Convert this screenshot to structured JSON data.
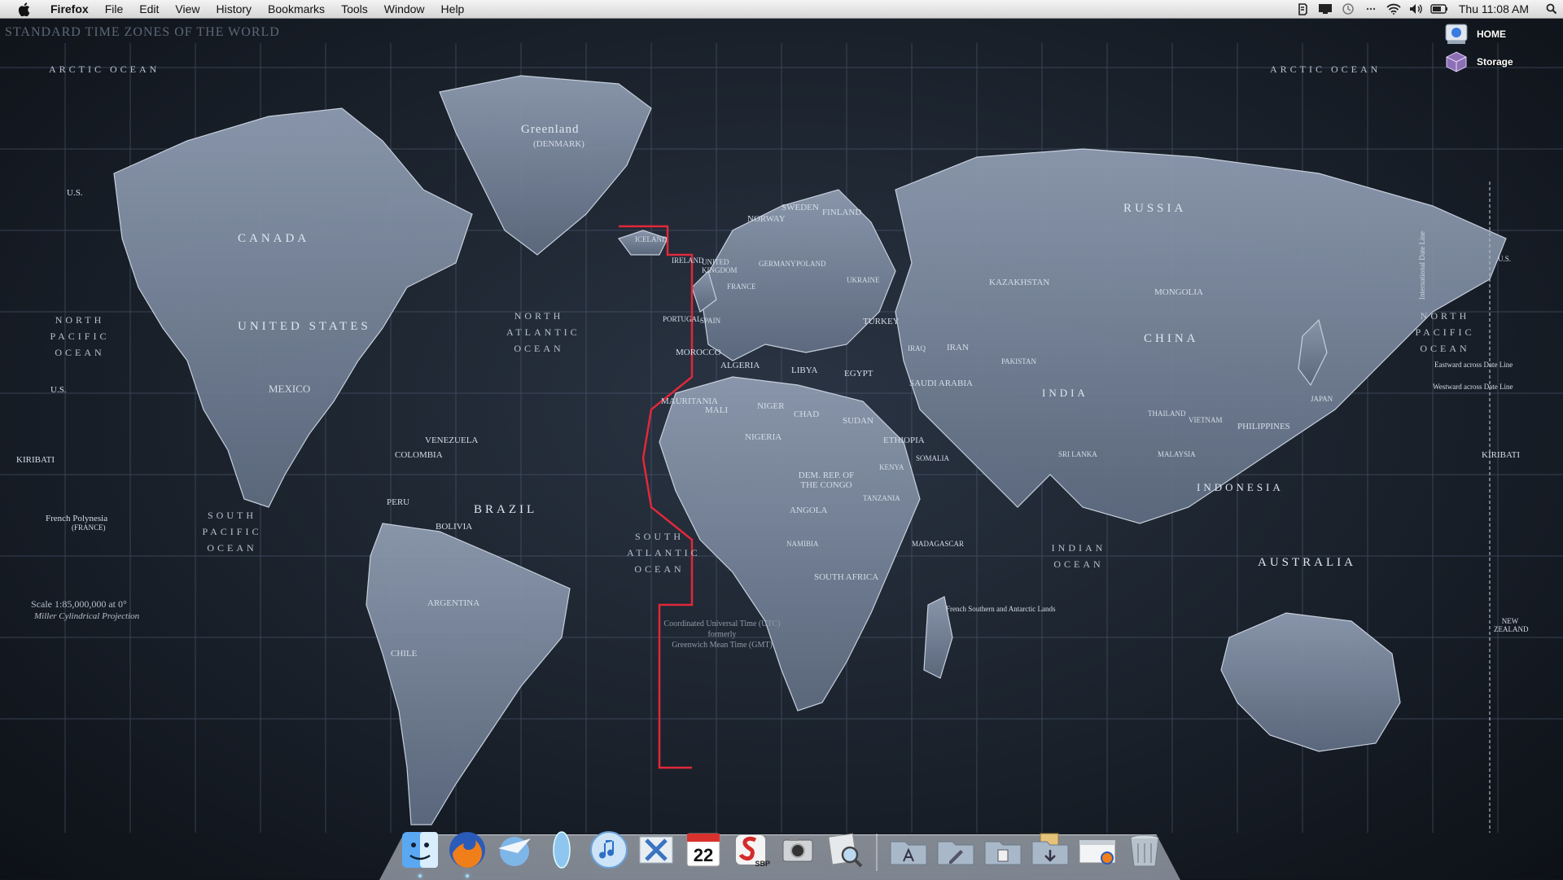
{
  "menubar": {
    "app": "Firefox",
    "items": [
      "File",
      "Edit",
      "View",
      "History",
      "Bookmarks",
      "Tools",
      "Window",
      "Help"
    ],
    "clock": "Thu 11:08 AM"
  },
  "desktop_icons": [
    {
      "label": "HOME",
      "icon": "home-drive-icon"
    },
    {
      "label": "Storage",
      "icon": "storage-drive-icon"
    }
  ],
  "map": {
    "title": "STANDARD TIME ZONES OF THE WORLD",
    "countries": [
      "Greenland",
      "(DENMARK)",
      "CANADA",
      "UNITED STATES",
      "MEXICO",
      "BRAZIL",
      "RUSSIA",
      "CHINA",
      "MONGOLIA",
      "KAZAKHSTAN",
      "INDIA",
      "AUSTRALIA",
      "INDONESIA",
      "ALGERIA",
      "LIBYA",
      "EGYPT",
      "SUDAN",
      "SAUDI ARABIA",
      "IRAN",
      "NIGER",
      "CHAD",
      "MALI",
      "ANGOLA",
      "PERU",
      "BOLIVIA",
      "ARGENTINA",
      "COLOMBIA",
      "VENEZUELA",
      "DEM. REP. OF THE CONGO",
      "ETHIOPIA",
      "PHILIPPINES",
      "MADAGASCAR",
      "TURKEY",
      "FINLAND",
      "SWEDEN",
      "NORWAY",
      "ICELAND",
      "MAURITANIA",
      "MOROCCO",
      "SOUTH AFRICA",
      "CHILE",
      "NIGERIA",
      "KENYA",
      "SOMALIA",
      "TANZANIA",
      "NAMIBIA",
      "IRAQ",
      "PAKISTAN",
      "SPAIN",
      "FRANCE",
      "POLAND",
      "UKRAINE",
      "GERMANY",
      "UNITED KINGDOM",
      "IRELAND",
      "MALAYSIA",
      "JAPAN",
      "NEW ZEALAND",
      "VIETNAM",
      "THAILAND",
      "SRI LANKA",
      "PORTUGAL"
    ],
    "oceans": [
      "NORTH PACIFIC OCEAN",
      "NORTH PACIFIC OCEAN",
      "NORTH ATLANTIC OCEAN",
      "SOUTH PACIFIC OCEAN",
      "SOUTH ATLANTIC OCEAN",
      "INDIAN OCEAN",
      "ARCTIC OCEAN",
      "ARCTIC OCEAN"
    ],
    "territories": [
      "U.S.",
      "U.S.",
      "U.S.",
      "KIRIBATI",
      "KIRIBATI",
      "French Polynesia",
      "(FRANCE)"
    ],
    "scale": "Scale 1:85,000,000 at 0°",
    "projection": "Miller Cylindrical Projection",
    "utc_note": [
      "Coordinated Universal Time (UTC)",
      "formerly",
      "Greenwich Mean Time (GMT)"
    ],
    "date_line": "International Date Line",
    "date_line_notes": [
      "Eastward across Date Line",
      "Westward across Date Line"
    ],
    "southern_lands": "French Southern and Antarctic Lands"
  },
  "dock": {
    "apps": [
      {
        "name": "Finder",
        "icon": "finder-icon",
        "running": true
      },
      {
        "name": "Firefox",
        "icon": "firefox-icon",
        "running": true
      },
      {
        "name": "Mail",
        "icon": "mail-icon",
        "running": false
      },
      {
        "name": "Dashboard",
        "icon": "dashboard-icon",
        "running": false
      },
      {
        "name": "iTunes",
        "icon": "itunes-icon",
        "running": false
      },
      {
        "name": "X11",
        "icon": "x11-icon",
        "running": false
      },
      {
        "name": "iCal",
        "icon": "ical-icon",
        "running": false,
        "date": "22"
      },
      {
        "name": "SBP",
        "icon": "sbp-icon",
        "running": false,
        "badge": "SBP"
      },
      {
        "name": "Photo Booth",
        "icon": "camera-icon",
        "running": false
      },
      {
        "name": "Preview",
        "icon": "preview-icon",
        "running": false
      }
    ],
    "stacks": [
      {
        "name": "Applications",
        "icon": "applications-folder-icon"
      },
      {
        "name": "Documents",
        "icon": "documents-folder-icon"
      },
      {
        "name": "Downloads",
        "icon": "downloads-folder-icon"
      },
      {
        "name": "Web",
        "icon": "web-window-icon"
      },
      {
        "name": "Trash",
        "icon": "trash-icon"
      }
    ]
  }
}
